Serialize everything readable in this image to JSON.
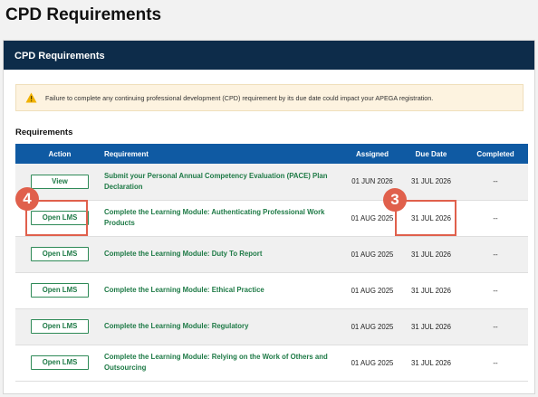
{
  "page": {
    "title": "CPD Requirements"
  },
  "card": {
    "header_title": "CPD Requirements"
  },
  "alert": {
    "icon": "warning-triangle",
    "text": "Failure to complete any continuing professional development (CPD) requirement by its due date could impact your APEGA registration."
  },
  "requirements": {
    "heading": "Requirements",
    "columns": {
      "action": "Action",
      "requirement": "Requirement",
      "assigned": "Assigned",
      "due": "Due Date",
      "completed": "Completed"
    },
    "rows": [
      {
        "action": "View",
        "requirement": "Submit your Personal Annual Competency Evaluation (PACE) Plan Declaration",
        "assigned": "01 JUN 2026",
        "due": "31 JUL 2026",
        "completed": "--"
      },
      {
        "action": "Open LMS",
        "requirement": "Complete the Learning Module: Authenticating Professional Work Products",
        "assigned": "01 AUG 2025",
        "due": "31 JUL 2026",
        "completed": "--"
      },
      {
        "action": "Open LMS",
        "requirement": "Complete the Learning Module: Duty To Report",
        "assigned": "01 AUG 2025",
        "due": "31 JUL 2026",
        "completed": "--"
      },
      {
        "action": "Open LMS",
        "requirement": "Complete the Learning Module: Ethical Practice",
        "assigned": "01 AUG 2025",
        "due": "31 JUL 2026",
        "completed": "--"
      },
      {
        "action": "Open LMS",
        "requirement": "Complete the Learning Module: Regulatory",
        "assigned": "01 AUG 2025",
        "due": "31 JUL 2026",
        "completed": "--"
      },
      {
        "action": "Open LMS",
        "requirement": "Complete the Learning Module: Relying on the Work of Others and Outsourcing",
        "assigned": "01 AUG 2025",
        "due": "31 JUL 2026",
        "completed": "--"
      }
    ]
  },
  "annotations": {
    "marker_action": "4",
    "marker_due": "3",
    "color": "#e0604c"
  },
  "colors": {
    "header_navy": "#0d2c4a",
    "table_header_blue": "#0f5aa3",
    "link_green": "#1e7a46",
    "alert_bg": "#fdf3e0"
  }
}
